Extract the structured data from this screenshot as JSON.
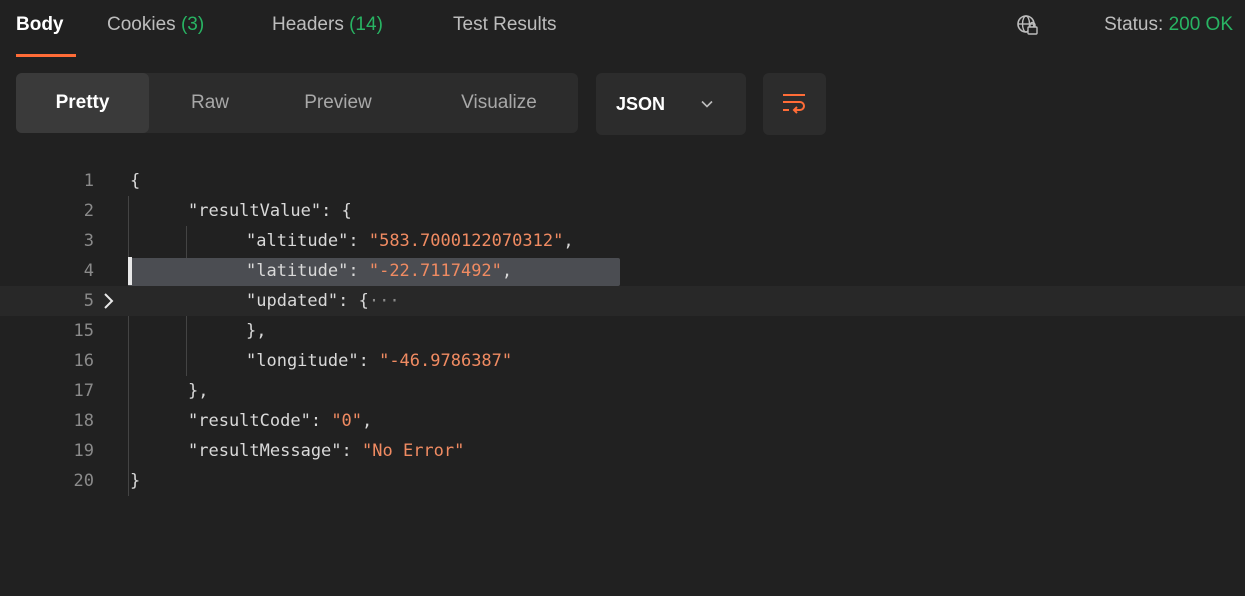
{
  "tabs": {
    "body": "Body",
    "cookies": "Cookies",
    "cookies_count": "(3)",
    "headers": "Headers",
    "headers_count": "(14)",
    "tests": "Test Results"
  },
  "status": {
    "label": "Status:",
    "value": "200 OK"
  },
  "toolbar": {
    "pretty": "Pretty",
    "raw": "Raw",
    "preview": "Preview",
    "visualize": "Visualize",
    "format": "JSON"
  },
  "code": {
    "lines": [
      {
        "n": "1",
        "open": "{"
      },
      {
        "n": "2",
        "key": "\"resultValue\"",
        "colon": ": ",
        "open": "{"
      },
      {
        "n": "3",
        "key": "\"altitude\"",
        "colon": ": ",
        "str": "\"583.7000122070312\"",
        "comma": ","
      },
      {
        "n": "4",
        "key": "\"latitude\"",
        "colon": ": ",
        "str": "\"-22.7117492\"",
        "comma": ","
      },
      {
        "n": "5",
        "key": "\"updated\"",
        "colon": ": ",
        "open": "{",
        "ellipsis": "···"
      },
      {
        "n": "15",
        "close": "},"
      },
      {
        "n": "16",
        "key": "\"longitude\"",
        "colon": ": ",
        "str": "\"-46.9786387\""
      },
      {
        "n": "17",
        "close": "},"
      },
      {
        "n": "18",
        "key": "\"resultCode\"",
        "colon": ": ",
        "str": "\"0\"",
        "comma": ","
      },
      {
        "n": "19",
        "key": "\"resultMessage\"",
        "colon": ": ",
        "str": "\"No Error\""
      },
      {
        "n": "20",
        "close": "}"
      }
    ]
  },
  "icons": {
    "globe": "globe-lock-icon",
    "chevron": "chevron-down-icon",
    "wrap": "word-wrap-icon",
    "fold": "chevron-right-icon"
  }
}
